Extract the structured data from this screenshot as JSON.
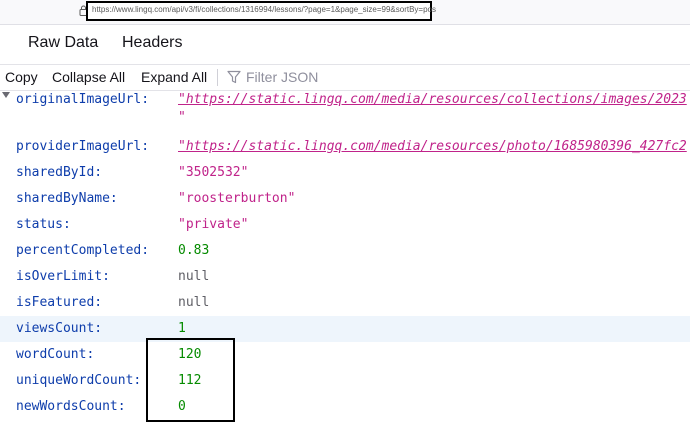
{
  "address_bar": {
    "url": "https://www.lingq.com/api/v3/fi/collections/1316994/lessons/?page=1&page_size=99&sortBy=pos"
  },
  "tabs": [
    {
      "label": "Raw Data"
    },
    {
      "label": "Headers"
    }
  ],
  "toolbar": {
    "copy": "Copy",
    "collapse_all": "Collapse All",
    "expand_all": "Expand All",
    "filter_placeholder": "Filter JSON"
  },
  "rows": [
    {
      "key": "originalImageUrl:",
      "value": "\"https://static.lingq.com/media/resources/collections/images/2023",
      "wrap": "\""
    },
    {
      "key": "providerImageUrl:",
      "value": "\"https://static.lingq.com/media/resources/photo/1685980396_427fc2"
    },
    {
      "key": "sharedById:",
      "value": "\"3502532\""
    },
    {
      "key": "sharedByName:",
      "value": "\"roosterburton\""
    },
    {
      "key": "status:",
      "value": "\"private\""
    },
    {
      "key": "percentCompleted:",
      "value": "0.83"
    },
    {
      "key": "isOverLimit:",
      "value": "null"
    },
    {
      "key": "isFeatured:",
      "value": "null"
    },
    {
      "key": "viewsCount:",
      "value": "1"
    },
    {
      "key": "wordCount:",
      "value": "120"
    },
    {
      "key": "uniqueWordCount:",
      "value": "112"
    },
    {
      "key": "newWordsCount:",
      "value": "0"
    }
  ]
}
